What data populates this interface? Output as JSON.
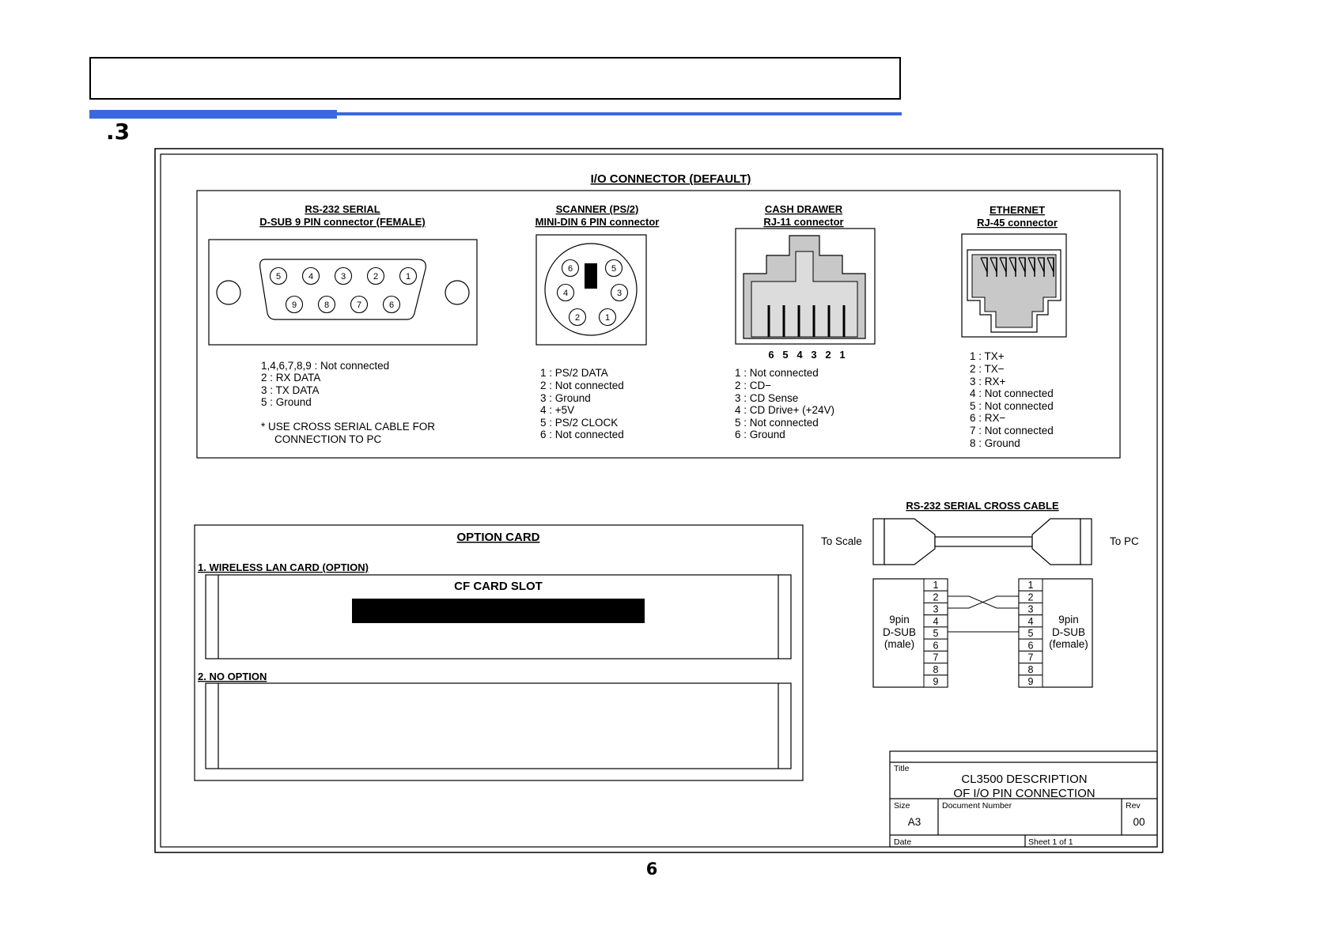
{
  "page": {
    "section_number": ".3",
    "page_number": "6"
  },
  "io": {
    "title": "I/O CONNECTOR (DEFAULT)",
    "rs232": {
      "title": "RS-232 SERIAL",
      "subtitle": "D-SUB 9 PIN connector (FEMALE)",
      "top_pins": [
        "5",
        "4",
        "3",
        "2",
        "1"
      ],
      "bottom_pins": [
        "9",
        "8",
        "7",
        "6"
      ],
      "notes": [
        "1,4,6,7,8,9 : Not connected",
        "2 : RX DATA",
        "3 : TX DATA",
        "5 : Ground"
      ],
      "remark": [
        "* USE CROSS SERIAL CABLE FOR",
        "CONNECTION TO PC"
      ]
    },
    "scanner": {
      "title": "SCANNER (PS/2)",
      "subtitle": "MINI-DIN 6 PIN connector",
      "pins": [
        "6",
        "5",
        "4",
        "3",
        "2",
        "1"
      ],
      "notes": [
        "1 : PS/2 DATA",
        "2 : Not connected",
        "3 : Ground",
        "4 : +5V",
        "5 : PS/2 CLOCK",
        "6 : Not connected"
      ]
    },
    "cash_drawer": {
      "title": "CASH DRAWER",
      "subtitle": "RJ-11 connector",
      "pin_numbers": [
        "6",
        "5",
        "4",
        "3",
        "2",
        "1"
      ],
      "notes": [
        "1 : Not connected",
        "2 : CD−",
        "3 : CD Sense",
        "4 : CD Drive+ (+24V)",
        "5 : Not connected",
        "6 : Ground"
      ]
    },
    "ethernet": {
      "title": "ETHERNET",
      "subtitle": "RJ-45 connector",
      "pin_numbers": [
        "1",
        "2",
        "3",
        "4",
        "5",
        "6",
        "7",
        "8"
      ],
      "notes": [
        "1 : TX+",
        "2 : TX−",
        "3 : RX+",
        "4 : Not connected",
        "5 : Not connected",
        "6 : RX−",
        "7 : Not connected",
        "8 : Ground"
      ]
    }
  },
  "option_card": {
    "title": "OPTION CARD",
    "item1_label": "1. WIRELESS LAN CARD (OPTION)",
    "slot_label": "CF CARD SLOT",
    "item2_label": "2. NO OPTION"
  },
  "cross_cable": {
    "title": "RS-232 SERIAL CROSS CABLE",
    "left_label": "To Scale",
    "right_label": "To PC",
    "pins": [
      "1",
      "2",
      "3",
      "4",
      "5",
      "6",
      "7",
      "8",
      "9"
    ],
    "left_connector": [
      "9pin",
      "D-SUB",
      "(male)"
    ],
    "right_connector": [
      "9pin",
      "D-SUB",
      "(female)"
    ]
  },
  "title_block": {
    "title_label": "Title",
    "title_lines": [
      "CL3500 DESCRIPTION",
      "OF I/O PIN CONNECTION"
    ],
    "size_label": "Size",
    "size_value": "A3",
    "doc_number_label": "Document Number",
    "rev_label": "Rev",
    "rev_value": "00",
    "date_label": "Date",
    "sheet_label": "Sheet 1 of 1"
  }
}
